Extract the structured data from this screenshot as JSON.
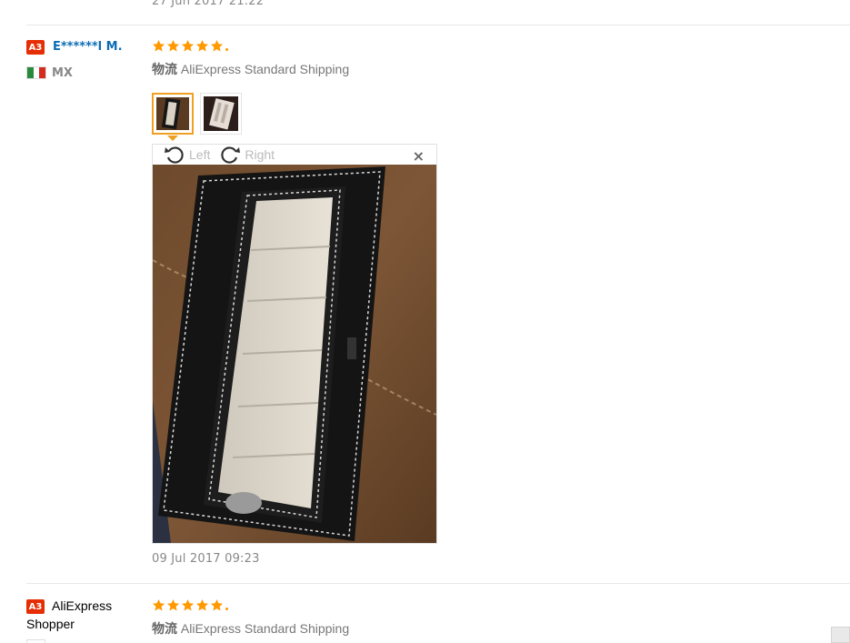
{
  "top_review": {
    "date": "27 Jun 2017 21:22"
  },
  "review1": {
    "level": "A3",
    "buyer_name": "E******l M.",
    "country": "MX",
    "rating": 5,
    "shipping_label": "物流",
    "shipping_method": "AliExpress Standard Shipping",
    "thumbnails": [
      {
        "alt": "photo-1"
      },
      {
        "alt": "photo-2"
      }
    ],
    "viewer": {
      "rotate_left": "Left",
      "rotate_right": "Right",
      "close": "×"
    },
    "date": "09 Jul 2017 09:23"
  },
  "review2": {
    "level": "A3",
    "buyer_name": "AliExpress Shopper",
    "rating": 5,
    "shipping_label": "物流",
    "shipping_method": "AliExpress Standard Shipping"
  },
  "colors": {
    "accent": "#f0a020",
    "badge": "#e62e04",
    "link": "#0b6cb6",
    "star": "#ff9900"
  },
  "icons": {
    "rotate_left": "rotate-left-icon",
    "rotate_right": "rotate-right-icon",
    "close": "close-icon",
    "star": "star-icon",
    "flag": "mexico-flag-icon"
  }
}
